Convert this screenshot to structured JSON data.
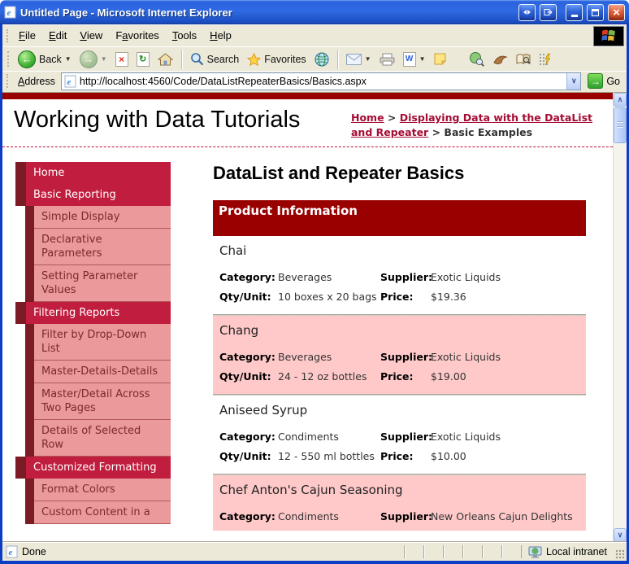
{
  "colors": {
    "accent_red": "#990000",
    "nav_header_bg": "#c11d3e",
    "nav_strip": "#7b1b24",
    "nav_sub_bg": "#ea9a9a",
    "nav_sub_text": "#7c2a2a",
    "alt_row_bg": "#ffc9c9",
    "link": "#a50b33"
  },
  "window": {
    "title": "Untitled Page - Microsoft Internet Explorer"
  },
  "menu": [
    {
      "label": "File",
      "u": 0
    },
    {
      "label": "Edit",
      "u": 0
    },
    {
      "label": "View",
      "u": 0
    },
    {
      "label": "Favorites",
      "u": 1
    },
    {
      "label": "Tools",
      "u": 0
    },
    {
      "label": "Help",
      "u": 0
    }
  ],
  "toolbar": {
    "back": "Back",
    "search": "Search",
    "favorites": "Favorites"
  },
  "address": {
    "label": "Address",
    "url": "http://localhost:4560/Code/DataListRepeaterBasics/Basics.aspx",
    "go": "Go"
  },
  "header": {
    "site_title": "Working with Data Tutorials",
    "breadcrumb": {
      "home": "Home",
      "sep1": ">",
      "section": "Displaying Data with the DataList and Repeater",
      "sep2": ">",
      "current": "Basic Examples"
    }
  },
  "sidebar": {
    "sections": [
      {
        "label": "Home",
        "items": []
      },
      {
        "label": "Basic Reporting",
        "items": [
          "Simple Display",
          "Declarative Parameters",
          "Setting Parameter Values"
        ]
      },
      {
        "label": "Filtering Reports",
        "items": [
          "Filter by Drop-Down List",
          "Master-Details-Details",
          "Master/Detail Across Two Pages",
          "Details of Selected Row"
        ]
      },
      {
        "label": "Customized Formatting",
        "items": [
          "Format Colors",
          "Custom Content in a"
        ]
      }
    ]
  },
  "main": {
    "heading": "DataList and Repeater Basics",
    "banner": "Product Information",
    "labels": {
      "category": "Category:",
      "supplier": "Supplier:",
      "qty": "Qty/Unit:",
      "price": "Price:"
    },
    "products": [
      {
        "name": "Chai",
        "category": "Beverages",
        "supplier": "Exotic Liquids",
        "qty": "10 boxes x 20 bags",
        "price": "$19.36",
        "alt": false
      },
      {
        "name": "Chang",
        "category": "Beverages",
        "supplier": "Exotic Liquids",
        "qty": "24 - 12 oz bottles",
        "price": "$19.00",
        "alt": true
      },
      {
        "name": "Aniseed Syrup",
        "category": "Condiments",
        "supplier": "Exotic Liquids",
        "qty": "12 - 550 ml bottles",
        "price": "$10.00",
        "alt": false
      },
      {
        "name": "Chef Anton's Cajun Seasoning",
        "category": "Condiments",
        "supplier": "New Orleans Cajun Delights",
        "qty": null,
        "price": null,
        "alt": true
      }
    ]
  },
  "statusbar": {
    "left": "Done",
    "zone": "Local intranet"
  }
}
